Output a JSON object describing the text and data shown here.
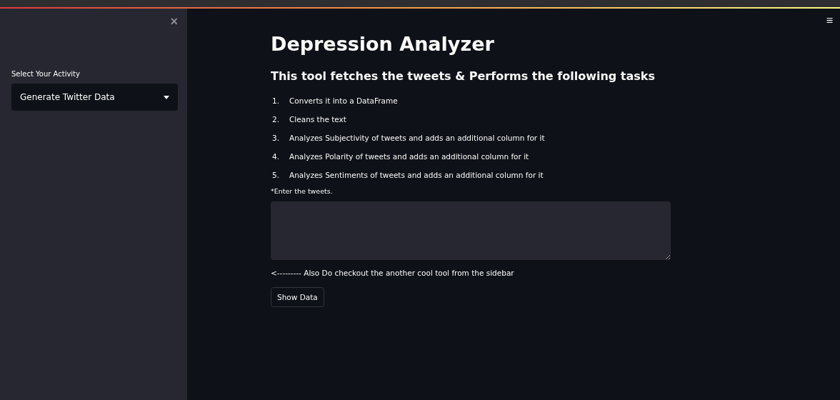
{
  "sidebar": {
    "close": "×",
    "select_label": "Select Your Activity",
    "select_value": "Generate Twitter Data"
  },
  "menu": "≡",
  "title": "Depression Analyzer",
  "subtitle": "This tool fetches the tweets & Performs the following tasks",
  "tasks": [
    {
      "num": "1.",
      "text": "Converts it into a DataFrame"
    },
    {
      "num": "2.",
      "text": "Cleans the text"
    },
    {
      "num": "3.",
      "text": "Analyzes Subjectivity of tweets and adds an additional column for it"
    },
    {
      "num": "4.",
      "text": "Analyzes Polarity of tweets and adds an additional column for it"
    },
    {
      "num": "5.",
      "text": "Analyzes Sentiments of tweets and adds an additional column for it"
    }
  ],
  "textarea_label": "*Enter the tweets.",
  "note": "<--------- Also Do checkout the another cool tool from the sidebar",
  "button": "Show Data"
}
